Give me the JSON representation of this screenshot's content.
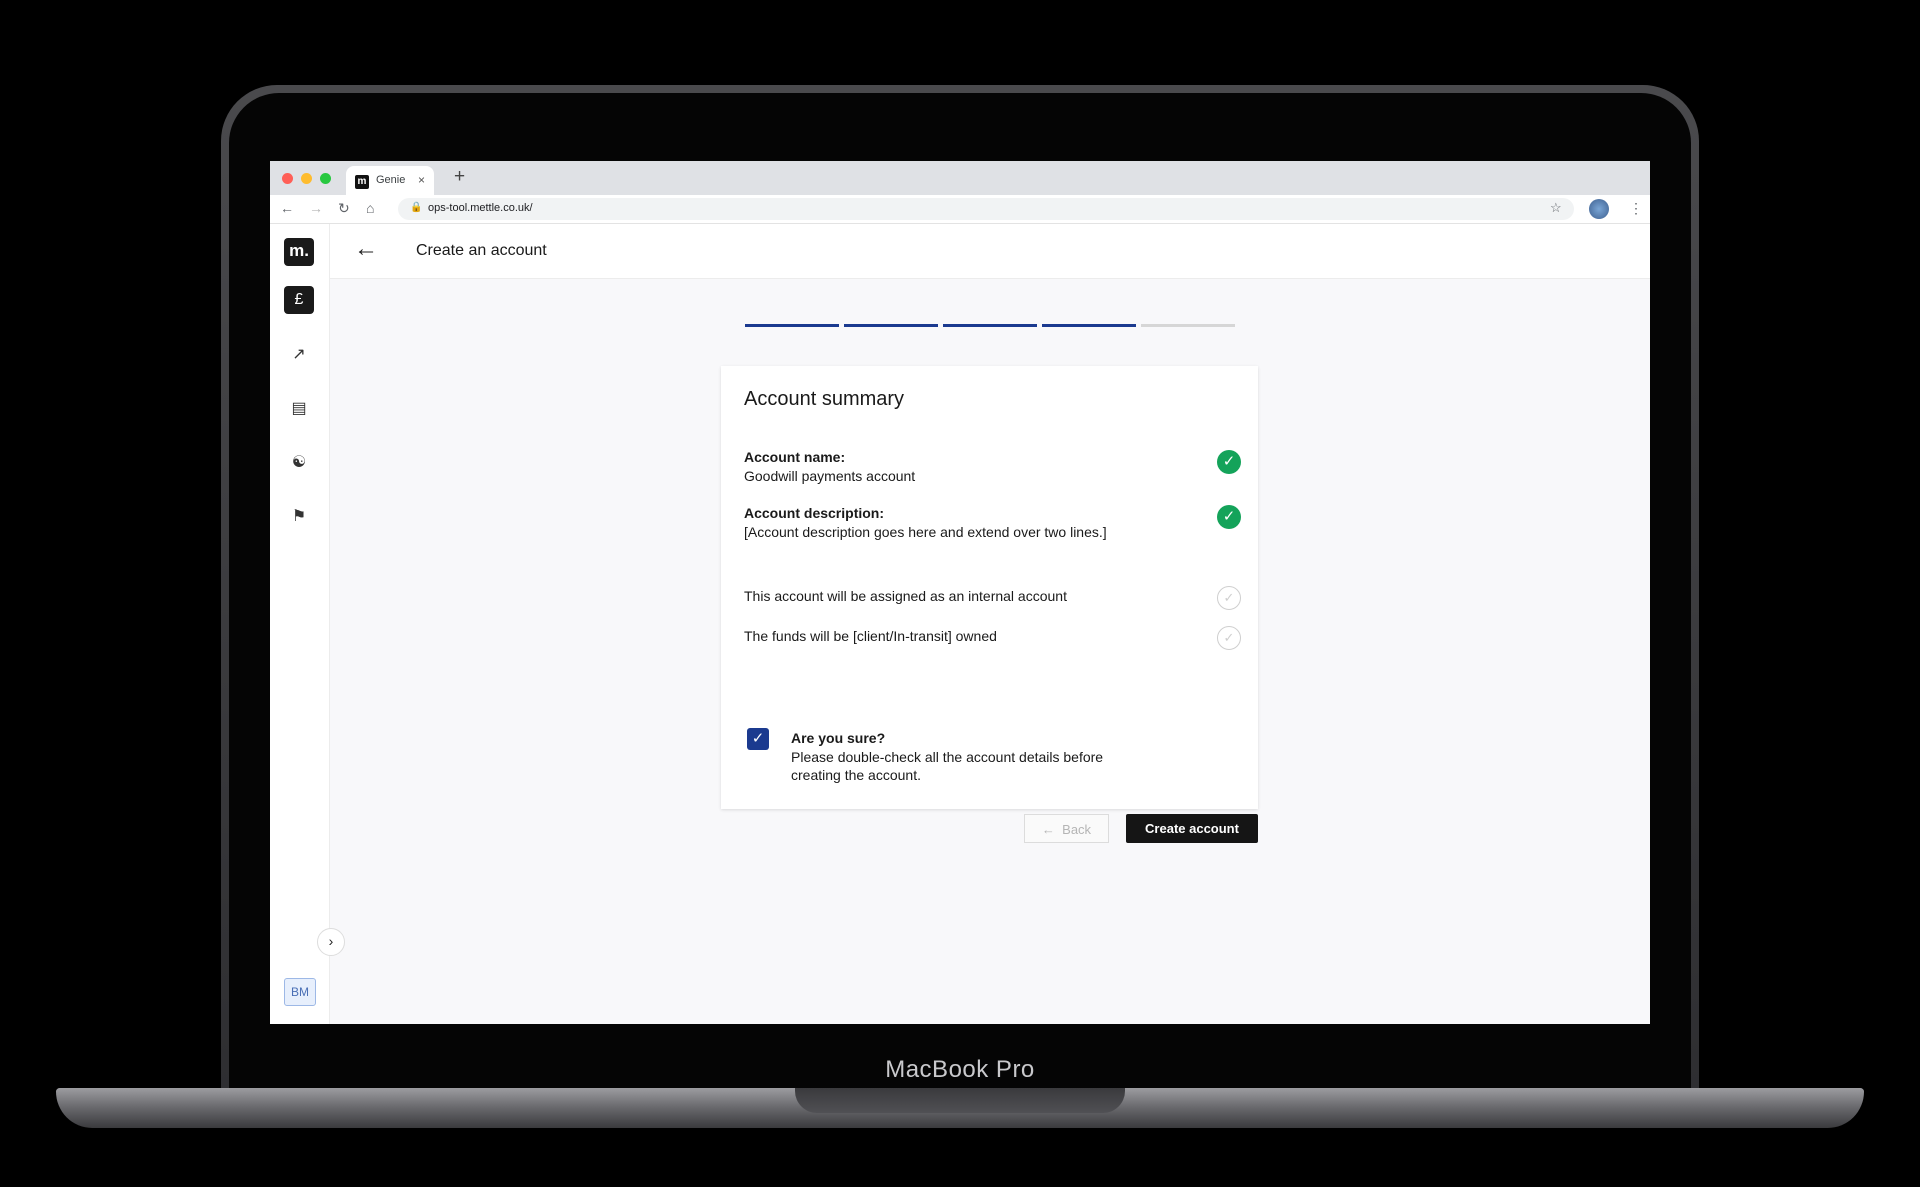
{
  "device": {
    "label": "MacBook Pro"
  },
  "browser": {
    "tab_title": "Genie",
    "favicon_letter": "m",
    "new_tab": "+",
    "tab_close": "×",
    "url": "ops-tool.mettle.co.uk/"
  },
  "app": {
    "logo": "m.",
    "page_title": "Create an account",
    "avatar_initials": "BM",
    "steps": {
      "total": 5,
      "completed": 4
    }
  },
  "summary": {
    "title": "Account summary",
    "name_label": "Account name:",
    "name_value": "Goodwill payments account",
    "desc_label": "Account description:",
    "desc_value": "[Account description goes here and extend over two lines.]",
    "internal_text": "This account will be assigned as an internal account",
    "funds_text": "The funds will be [client/In-transit] owned",
    "confirm_title": "Are you sure?",
    "confirm_line1": "Please double-check all the account details  before",
    "confirm_line2": "creating the account.",
    "confirm_checked": true
  },
  "actions": {
    "back_label": "Back",
    "create_label": "Create account"
  },
  "colors": {
    "accent": "#1b3a8f",
    "success": "#14a35a",
    "primary_button": "#151515"
  }
}
